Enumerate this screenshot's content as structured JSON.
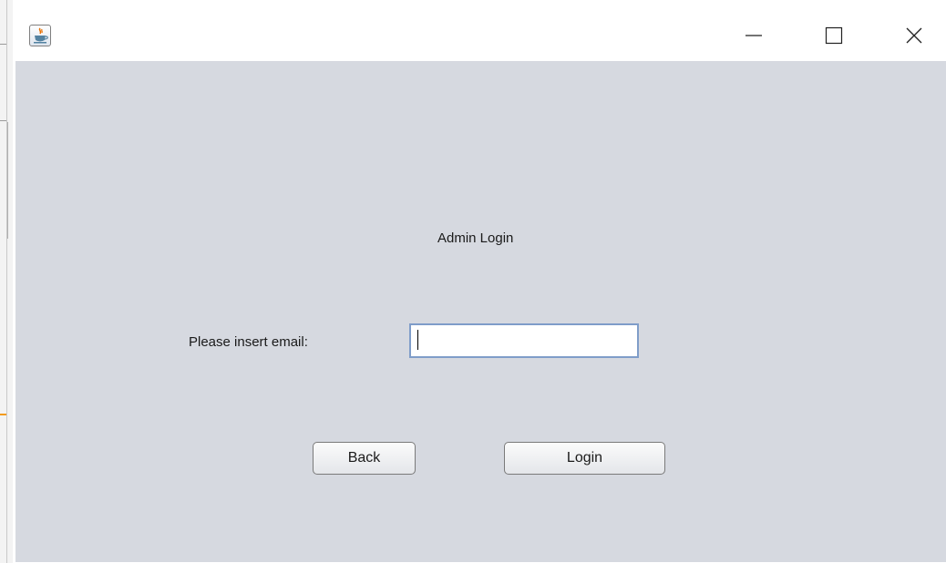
{
  "window": {
    "icon": "java-icon",
    "controls": {
      "minimize": "minimize-icon",
      "maximize": "maximize-icon",
      "close": "close-icon"
    }
  },
  "form": {
    "title": "Admin Login",
    "email_label": "Please insert email:",
    "email_value": "",
    "back_label": "Back",
    "login_label": "Login"
  },
  "colors": {
    "content_background": "#d6d9e0",
    "input_focus_border": "#7f9dc9",
    "background_window_accent": "#f29b1d"
  }
}
